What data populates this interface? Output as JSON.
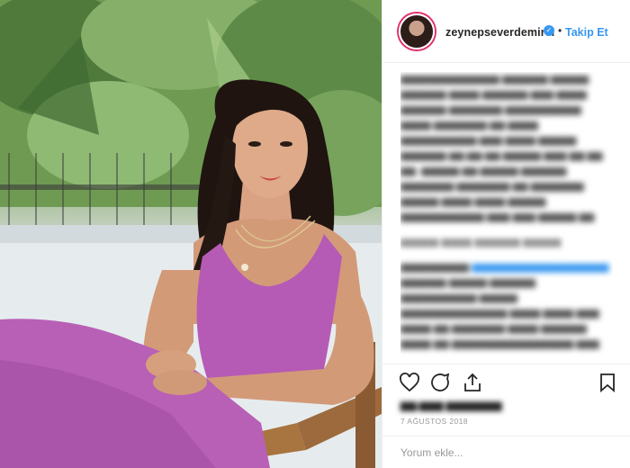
{
  "header": {
    "username": "zeynepseverdemirel",
    "verified_icon": "verified-badge-icon",
    "separator": "•",
    "follow_label": "Takip Et"
  },
  "post": {
    "date": "7 AĞUSTOS 2018",
    "comment_placeholder": "Yorum ekle..."
  },
  "colors": {
    "accent_blue": "#3897f0",
    "text_dark": "#262626",
    "muted": "#999999",
    "dress": "#b65bb5"
  },
  "icons": [
    "heart-icon",
    "comment-icon",
    "share-icon",
    "bookmark-icon"
  ]
}
